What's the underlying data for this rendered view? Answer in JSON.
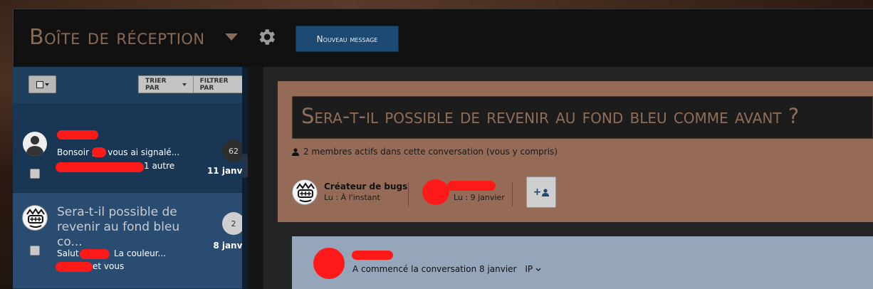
{
  "header": {
    "title": "Boîte de réception",
    "new_message": "Nouveau message"
  },
  "sidebar": {
    "sort_label": "TRIER PAR",
    "filter_label": "FILTRER PAR",
    "conversations": [
      {
        "preview": "Bonsoir , Je vous ai signalé...",
        "participants": "1 autre",
        "count": "62",
        "date": "11 janv."
      },
      {
        "title": "Sera-t-il possible de revenir au fond bleu co...",
        "preview_start": "Salut",
        "preview_end": "La couleur...",
        "participants": "et vous",
        "count": "2",
        "date": "8 janv."
      }
    ]
  },
  "main": {
    "heading": "Sera-t-il possible de revenir au fond bleu comme avant ?",
    "members_text": "2 membres actifs dans cette conversation (vous y compris)",
    "participants": [
      {
        "name": "Créateur de bugs",
        "status": "Lu : À l'instant"
      },
      {
        "name": "",
        "status": "Lu : 9 janvier"
      }
    ],
    "message": {
      "started": "A commencé la conversation 8 janvier",
      "ip": "IP"
    }
  },
  "colors": {
    "accent_blue": "#1d4a72",
    "title_brown": "#8a6a55",
    "redaction": "#ff1a1a"
  }
}
